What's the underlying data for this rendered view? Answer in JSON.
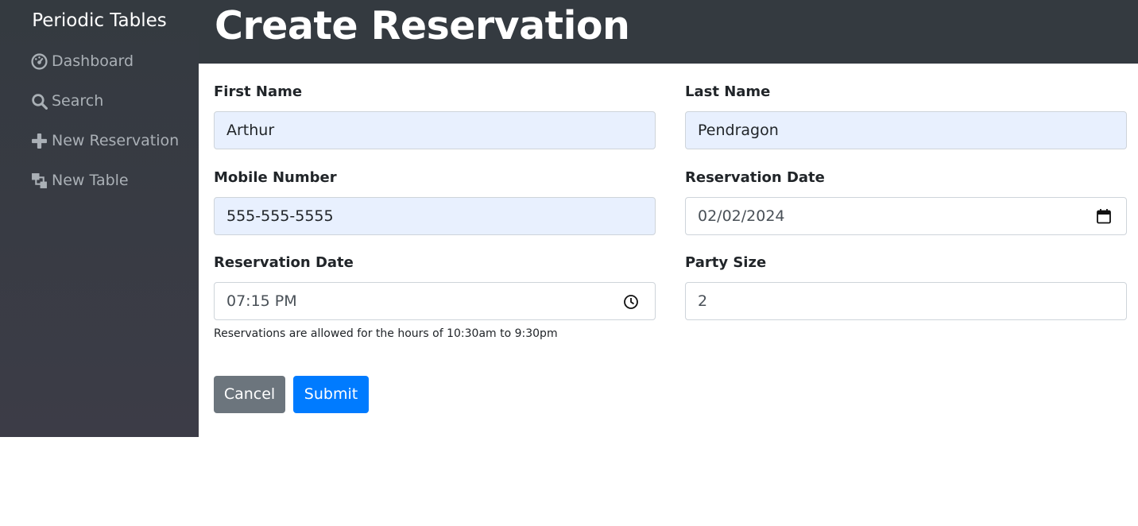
{
  "sidebar": {
    "brand": "Periodic Tables",
    "items": [
      {
        "label": "Dashboard",
        "icon": "dashboard-icon"
      },
      {
        "label": "Search",
        "icon": "search-icon"
      },
      {
        "label": "New Reservation",
        "icon": "plus-icon"
      },
      {
        "label": "New Table",
        "icon": "layers-icon"
      }
    ]
  },
  "header": {
    "title": "Create Reservation"
  },
  "form": {
    "first_name": {
      "label": "First Name",
      "value": "Arthur"
    },
    "last_name": {
      "label": "Last Name",
      "value": "Pendragon"
    },
    "mobile_number": {
      "label": "Mobile Number",
      "value": "555-555-5555"
    },
    "reservation_date": {
      "label": "Reservation Date",
      "value": "02/02/2024"
    },
    "reservation_time": {
      "label": "Reservation Date",
      "value": "07:15 PM",
      "help": "Reservations are allowed for the hours of 10:30am to 9:30pm"
    },
    "party_size": {
      "label": "Party Size",
      "value": "2"
    },
    "cancel_label": "Cancel",
    "submit_label": "Submit"
  },
  "colors": {
    "sidebar": "#343a40",
    "header": "#343a40",
    "autofill": "#e8f0fe",
    "cancel": "#6c757d",
    "submit": "#007bff"
  }
}
